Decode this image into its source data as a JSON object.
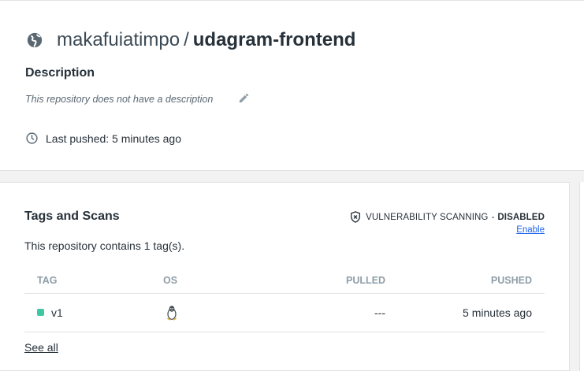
{
  "repo": {
    "owner": "makafuiatimpo",
    "separator": "/",
    "name": "udagram-frontend",
    "description_heading": "Description",
    "description_text": "This repository does not have a description",
    "last_pushed": "Last pushed: 5 minutes ago"
  },
  "tags_section": {
    "title": "Tags and Scans",
    "vulnerability_label": "VULNERABILITY SCANNING",
    "vulnerability_sep": "-",
    "vulnerability_status": "DISABLED",
    "enable_link": "Enable",
    "tag_count_text": "This repository contains 1 tag(s).",
    "columns": [
      "TAG",
      "OS",
      "PULLED",
      "PUSHED"
    ],
    "rows": [
      {
        "tag": "v1",
        "os_icon": "linux-icon",
        "pulled": "---",
        "pushed": "5 minutes ago",
        "status_color": "#3fc7a2"
      }
    ],
    "see_all": "See all"
  },
  "colors": {
    "accent": "#1d63ed",
    "status_ok": "#3fc7a2",
    "muted_header": "#8f9ea8"
  },
  "icons": [
    "globe-icon",
    "edit-icon",
    "clock-icon",
    "shield-icon",
    "linux-icon"
  ]
}
